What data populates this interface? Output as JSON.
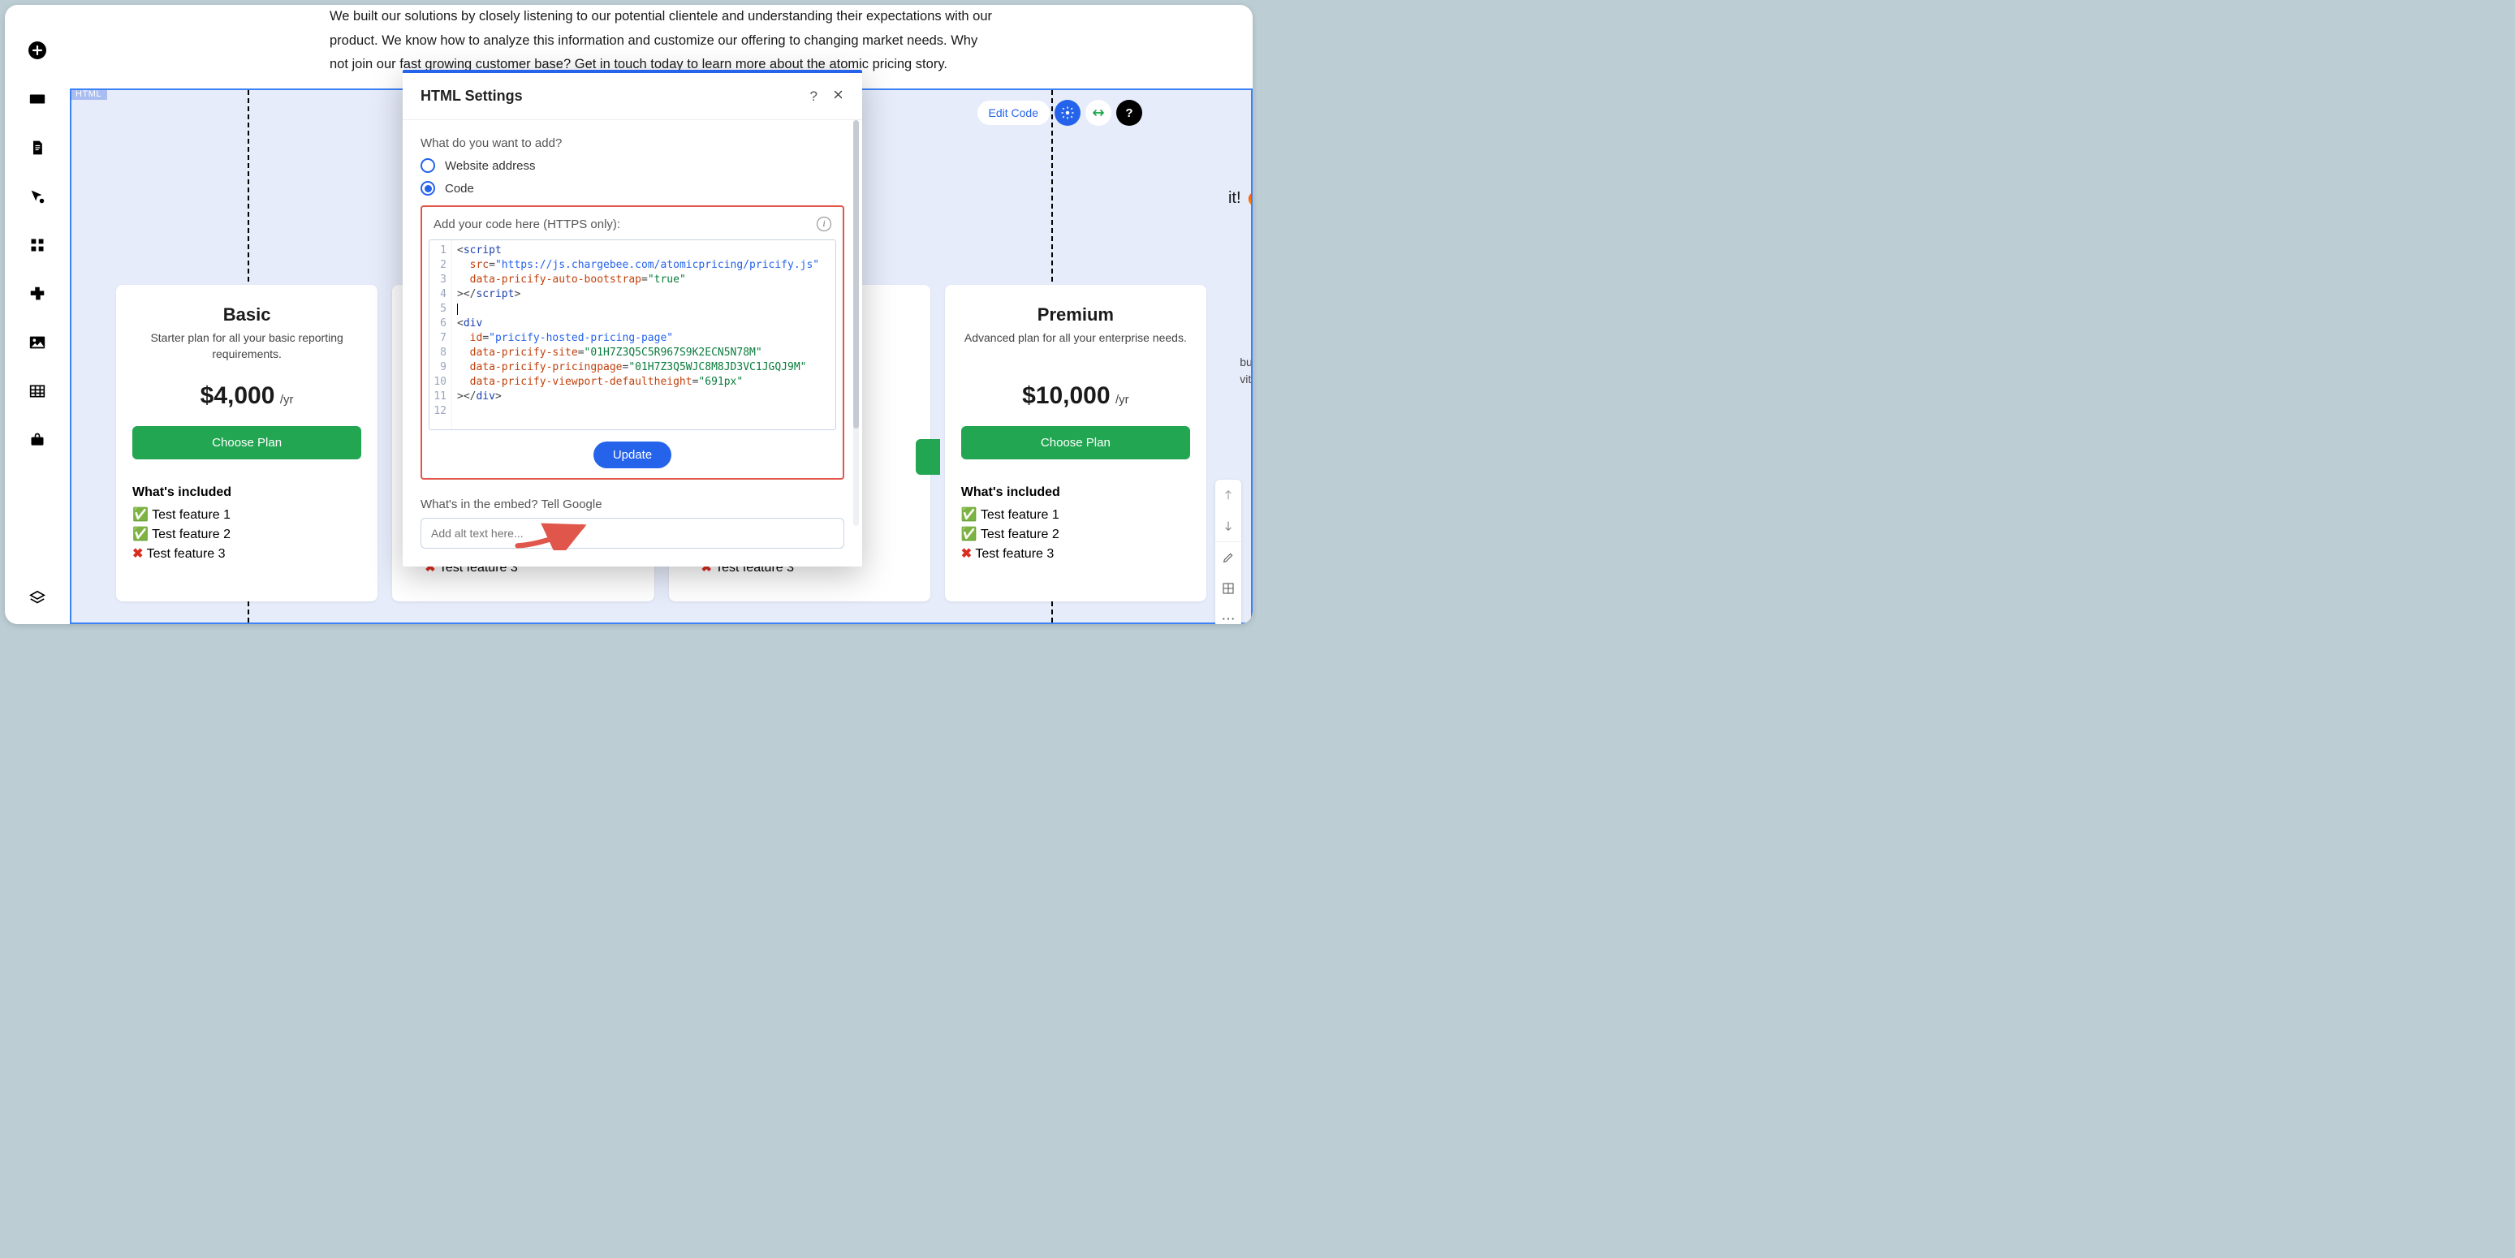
{
  "content_paragraph": "We built our solutions by closely listening to our potential clientele and understanding their expectations with our product. We know how to analyze this information and customize our offering to changing market needs. Why not join our fast growing customer base? Get in touch today to learn more about the atomic pricing story.",
  "html_block": {
    "tag": "HTML"
  },
  "toolbar": {
    "edit_code": "Edit Code"
  },
  "bg_text_1": "it! 🔥",
  "bg_text_2": "but\nvith",
  "plans": [
    {
      "name": "Basic",
      "desc": "Starter plan for all your basic reporting requirements.",
      "price": "$4,000",
      "period": "/yr",
      "cta": "Choose Plan",
      "included_title": "What's included",
      "features": [
        {
          "ok": true,
          "label": "Test feature 1"
        },
        {
          "ok": true,
          "label": "Test feature 2"
        },
        {
          "ok": false,
          "label": "Test feature 3"
        }
      ]
    },
    {
      "name": "",
      "desc": "",
      "price": "",
      "period": "",
      "cta": "",
      "included_title": "",
      "features": [
        {
          "ok": false,
          "label": "Test feature 3"
        }
      ]
    },
    {
      "name": "",
      "desc": "",
      "price": "",
      "period": "",
      "cta": "",
      "included_title": "",
      "features": [
        {
          "ok": false,
          "label": "Test feature 3"
        }
      ]
    },
    {
      "name": "Premium",
      "desc": "Advanced plan for all your enterprise needs.",
      "price": "$10,000",
      "period": "/yr",
      "cta": "Choose Plan",
      "included_title": "What's included",
      "features": [
        {
          "ok": true,
          "label": "Test feature 1"
        },
        {
          "ok": true,
          "label": "Test feature 2"
        },
        {
          "ok": false,
          "label": "Test feature 3"
        }
      ]
    }
  ],
  "modal": {
    "title": "HTML Settings",
    "question": "What do you want to add?",
    "option_url": "Website address",
    "option_code": "Code",
    "code_label": "Add your code here (HTTPS only):",
    "code_lines": [
      [
        {
          "c": "t-punct",
          "t": "<"
        },
        {
          "c": "t-tag",
          "t": "script"
        }
      ],
      [
        {
          "c": "",
          "t": "  "
        },
        {
          "c": "t-attr",
          "t": "src"
        },
        {
          "c": "t-punct",
          "t": "="
        },
        {
          "c": "t-str-long",
          "t": "\"https://js.chargebee.com/atomicpricing/pricify.js\""
        }
      ],
      [
        {
          "c": "",
          "t": "  "
        },
        {
          "c": "t-attr",
          "t": "data-pricify-auto-bootstrap"
        },
        {
          "c": "t-punct",
          "t": "="
        },
        {
          "c": "t-str",
          "t": "\"true\""
        }
      ],
      [
        {
          "c": "t-punct",
          "t": ">"
        },
        {
          "c": "t-punct",
          "t": "</"
        },
        {
          "c": "t-tag",
          "t": "script"
        },
        {
          "c": "t-punct",
          "t": ">"
        }
      ],
      [
        {
          "c": "cursor",
          "t": ""
        }
      ],
      [
        {
          "c": "t-punct",
          "t": "<"
        },
        {
          "c": "t-tag",
          "t": "div"
        }
      ],
      [
        {
          "c": "",
          "t": "  "
        },
        {
          "c": "t-attr",
          "t": "id"
        },
        {
          "c": "t-punct",
          "t": "="
        },
        {
          "c": "t-str-long",
          "t": "\"pricify-hosted-pricing-page\""
        }
      ],
      [
        {
          "c": "",
          "t": "  "
        },
        {
          "c": "t-attr",
          "t": "data-pricify-site"
        },
        {
          "c": "t-punct",
          "t": "="
        },
        {
          "c": "t-str",
          "t": "\"01H7Z3Q5C5R967S9K2ECN5N78M\""
        }
      ],
      [
        {
          "c": "",
          "t": "  "
        },
        {
          "c": "t-attr",
          "t": "data-pricify-pricingpage"
        },
        {
          "c": "t-punct",
          "t": "="
        },
        {
          "c": "t-str",
          "t": "\"01H7Z3Q5WJC8M8JD3VC1JGQJ9M\""
        }
      ],
      [
        {
          "c": "",
          "t": "  "
        },
        {
          "c": "t-attr",
          "t": "data-pricify-viewport-defaultheight"
        },
        {
          "c": "t-punct",
          "t": "="
        },
        {
          "c": "t-str",
          "t": "\"691px\""
        }
      ],
      [
        {
          "c": "t-punct",
          "t": ">"
        },
        {
          "c": "t-punct",
          "t": "</"
        },
        {
          "c": "t-tag",
          "t": "div"
        },
        {
          "c": "t-punct",
          "t": ">"
        }
      ],
      []
    ],
    "update": "Update",
    "seo_label": "What's in the embed? Tell Google",
    "alt_placeholder": "Add alt text here..."
  }
}
